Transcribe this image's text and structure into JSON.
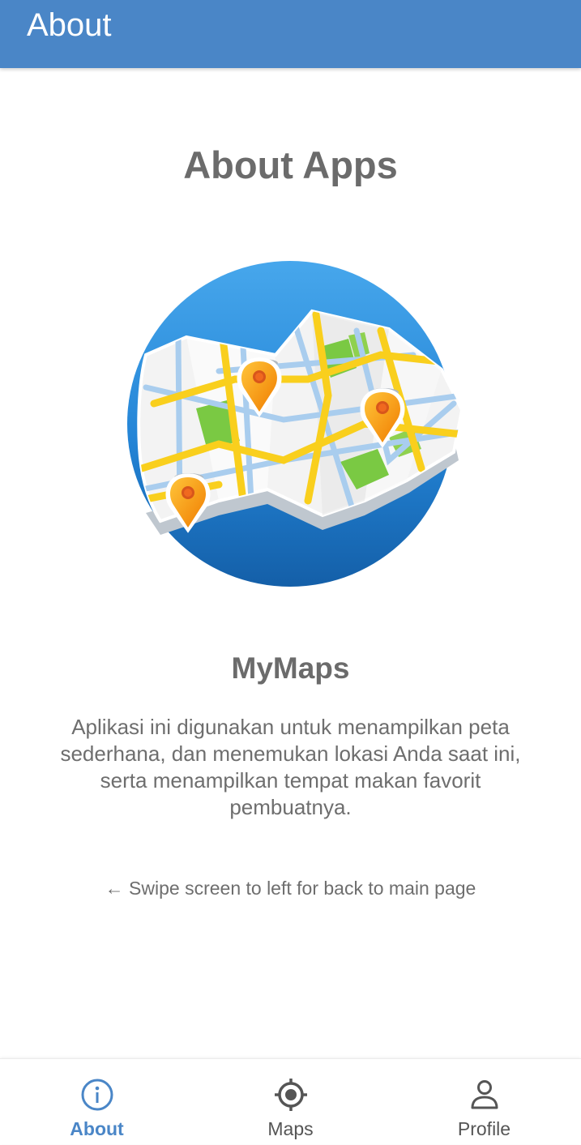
{
  "app_bar": {
    "title": "About"
  },
  "main": {
    "heading": "About Apps",
    "illustration_icon": "folded-map-with-pins-icon",
    "app_name": "MyMaps",
    "description": "Aplikasi ini digunakan untuk menampilkan peta sederhana, dan menemukan lokasi Anda saat ini, serta menampilkan tempat makan favorit pembuatnya.",
    "hint": "← Swipe screen to left for back to main page"
  },
  "bottom_nav": {
    "active": "About",
    "items": [
      {
        "label": "About",
        "icon": "info-icon"
      },
      {
        "label": "Maps",
        "icon": "location-target-icon"
      },
      {
        "label": "Profile",
        "icon": "person-icon"
      }
    ]
  },
  "colors": {
    "primary": "#4a86c7",
    "text_gray": "#6b6b6b",
    "map_circle_blue": "#1f7ccd",
    "road_yellow": "#f9cf1d",
    "park_green": "#7ac943",
    "pin_orange": "#f5a01a"
  }
}
